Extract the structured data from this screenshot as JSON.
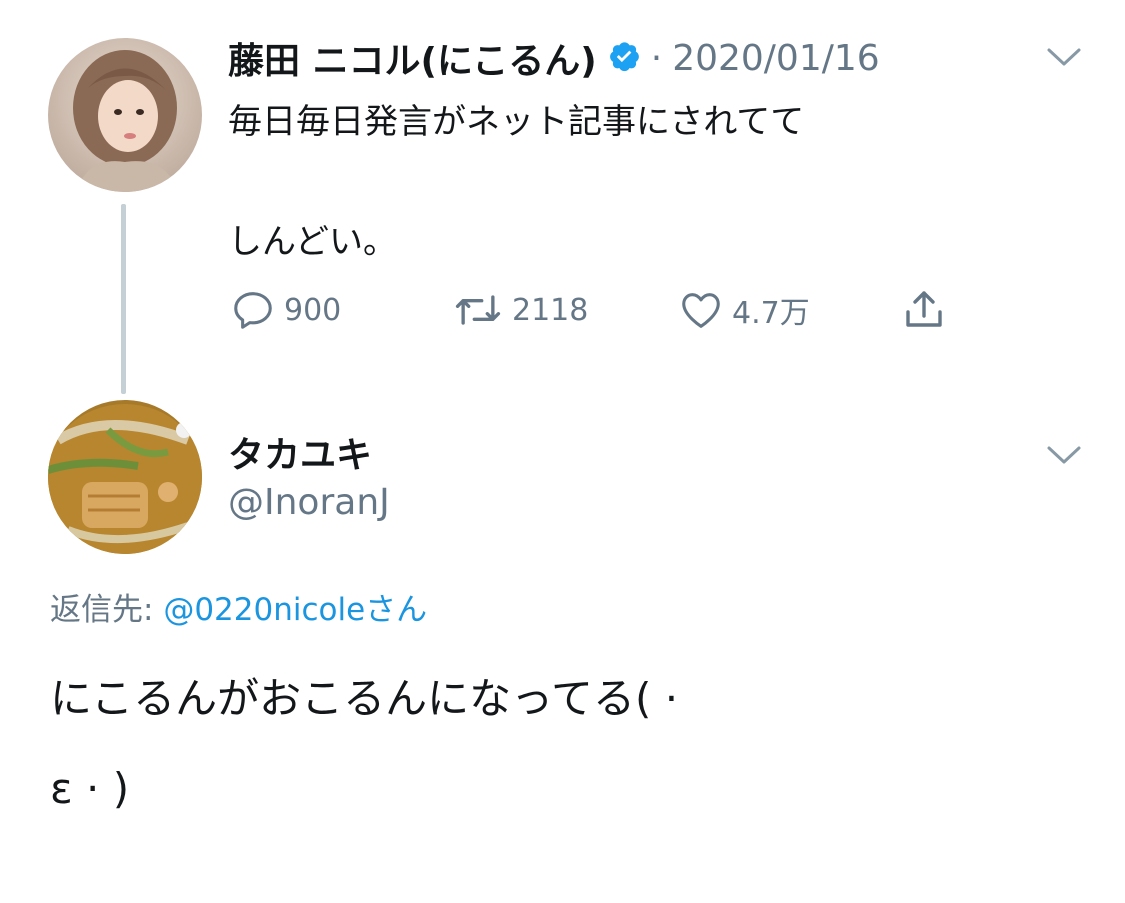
{
  "original_tweet": {
    "author_name": "藤田 ニコル(にこるん)",
    "separator": "·",
    "date": "2020/01/16",
    "text_line1": "毎日毎日発言がネット記事にされてて",
    "text_line2": "しんどい。",
    "replies": "900",
    "retweets": "2118",
    "likes": "4.7万"
  },
  "reply_tweet": {
    "author_name": "タカユキ",
    "handle": "@InoranJ",
    "reply_prefix": "返信先: ",
    "reply_to": "@0220nicoleさん",
    "text_line1": "にこるんがおこるんになってる( ·",
    "text_line2": "ε · )"
  },
  "colors": {
    "verified": "#1da1f2",
    "link": "#1b95e0",
    "muted": "#657786",
    "thread_line": "#c4cfd6"
  },
  "icons": [
    "verified-badge-icon",
    "chevron-down-icon",
    "reply-icon",
    "retweet-icon",
    "like-icon",
    "share-icon"
  ]
}
